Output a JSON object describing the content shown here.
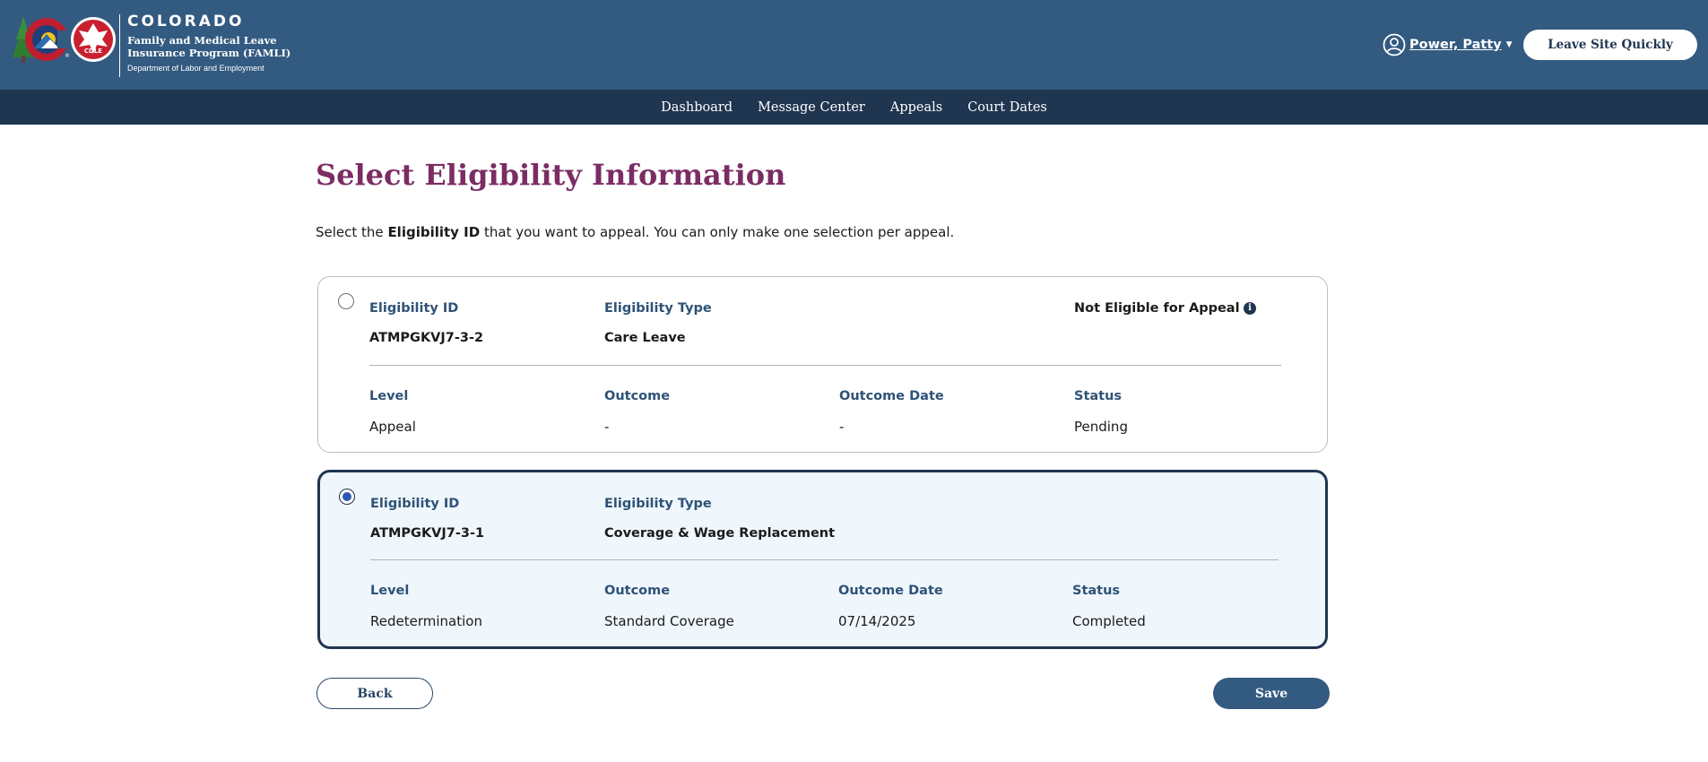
{
  "header": {
    "logo": {
      "state": "COLORADO",
      "program": "Family and Medical Leave Insurance Program (FAMLI)",
      "department": "Department of Labor and Employment",
      "seal_text": "CDLE"
    },
    "user": {
      "name": "Power, Patty",
      "icon": "user-circle-icon"
    },
    "leave_site_label": "Leave Site Quickly"
  },
  "nav": {
    "items": [
      {
        "label": "Dashboard"
      },
      {
        "label": "Message Center"
      },
      {
        "label": "Appeals"
      },
      {
        "label": "Court Dates"
      }
    ]
  },
  "main": {
    "title": "Select Eligibility Information",
    "intro": {
      "prefix": "Select the ",
      "bold": "Eligibility ID",
      "suffix": " that you want to appeal. You can only make one selection per appeal."
    },
    "labels": {
      "eligibility_id": "Eligibility ID",
      "eligibility_type": "Eligibility Type",
      "level": "Level",
      "outcome": "Outcome",
      "outcome_date": "Outcome Date",
      "status": "Status"
    },
    "cards": [
      {
        "selected": false,
        "eligibility_id": "ATMPGKVJ7-3-2",
        "eligibility_type": "Care Leave",
        "notice": "Not Eligible for Appeal",
        "level": "Appeal",
        "outcome": "-",
        "outcome_date": "-",
        "status": "Pending"
      },
      {
        "selected": true,
        "eligibility_id": "ATMPGKVJ7-3-1",
        "eligibility_type": "Coverage & Wage Replacement",
        "level": "Redetermination",
        "outcome": "Standard Coverage",
        "outcome_date": "07/14/2025",
        "status": "Completed"
      }
    ],
    "back_label": "Back",
    "save_label": "Save"
  },
  "colors": {
    "header_bg": "#335a80",
    "nav_bg": "#1f3550",
    "title": "#7b2d63",
    "label": "#2f5276",
    "selected_card_bg": "#eff6fc"
  }
}
